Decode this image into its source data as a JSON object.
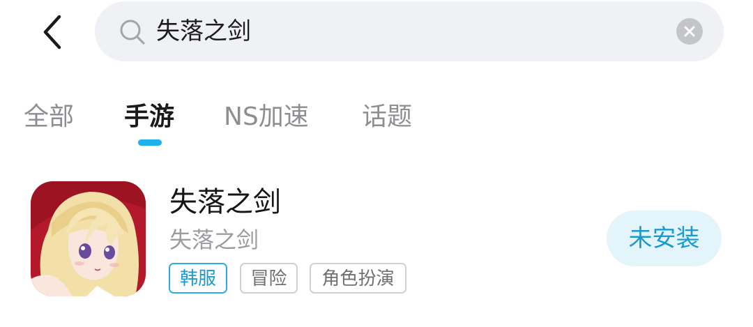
{
  "header": {
    "search": {
      "value": "失落之剑"
    }
  },
  "tabs": [
    {
      "label": "全部",
      "active": false
    },
    {
      "label": "手游",
      "active": true
    },
    {
      "label": "NS加速",
      "active": false
    },
    {
      "label": "话题",
      "active": false
    }
  ],
  "results": [
    {
      "name": "失落之剑",
      "subtitle": "失落之剑",
      "tags": [
        "韩服",
        "冒险",
        "角色扮演"
      ],
      "action_label": "未安装"
    }
  ],
  "colors": {
    "accent": "#1fb1e9",
    "action_bg": "#e4f4fb",
    "action_text": "#1a9ad0",
    "search_bg": "#f0f1f5"
  },
  "icons": {
    "back": "chevron-left-icon",
    "search": "search-icon",
    "clear": "clear-icon",
    "app": "app-icon"
  }
}
